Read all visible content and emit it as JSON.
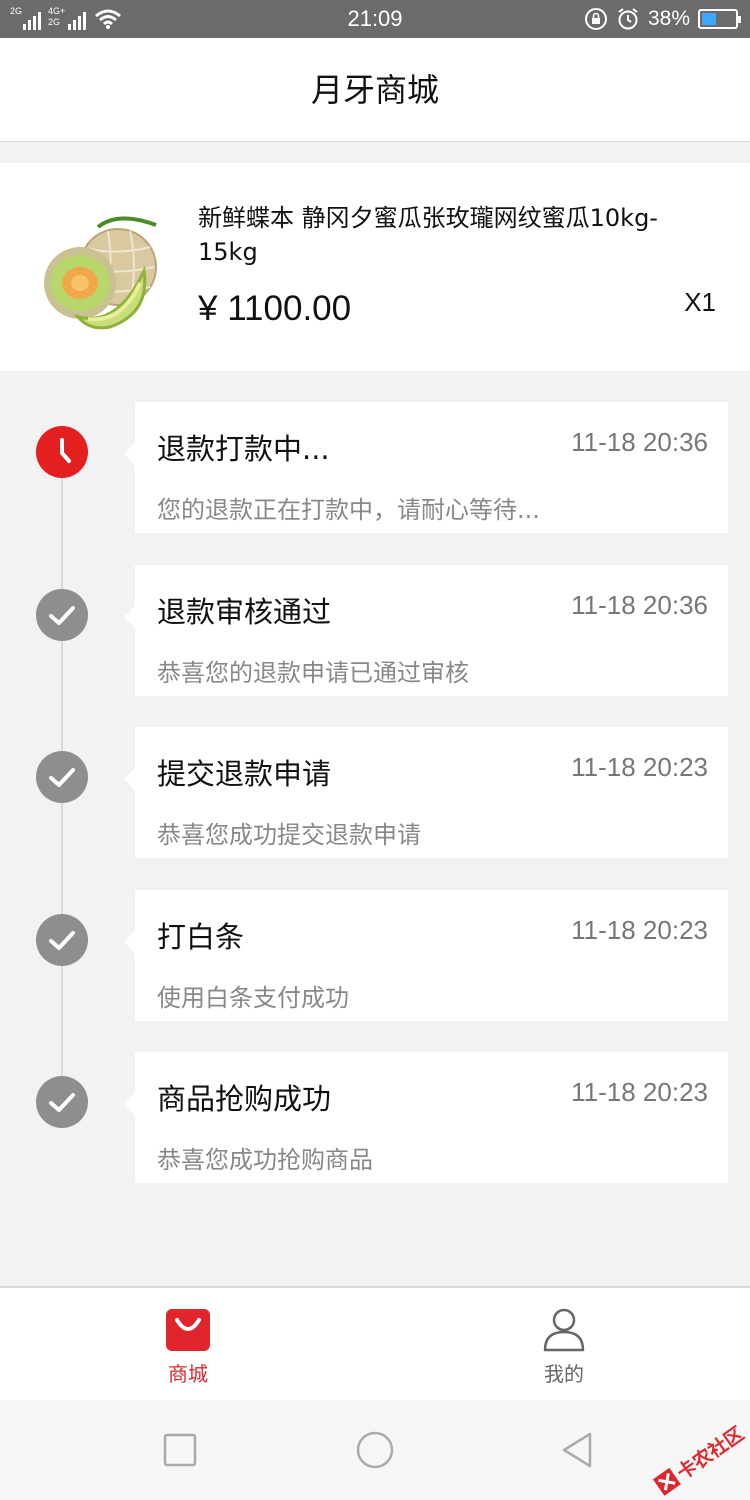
{
  "status_bar": {
    "time": "21:09",
    "battery": "38%",
    "battery_level": 0.38,
    "sim1_label": "2G",
    "sim2_label_top": "4G+",
    "sim2_label_bottom": "2G",
    "icons": [
      "signal-icon",
      "signal-icon",
      "wifi-icon",
      "lock-rotation-icon",
      "alarm-icon",
      "battery-icon"
    ]
  },
  "header": {
    "title": "月牙商城"
  },
  "product": {
    "name": "新鲜蝶本 静冈夕蜜瓜张玫瓏网纹蜜瓜10kg-15kg",
    "price": "¥ 1100.00",
    "quantity": "X1",
    "image_icon": "melon-image"
  },
  "timeline": [
    {
      "title": "退款打款中...",
      "time": "11-18 20:36",
      "desc": "您的退款正在打款中，请耐心等待...",
      "status": "active",
      "icon": "clock-icon"
    },
    {
      "title": "退款审核通过",
      "time": "11-18 20:36",
      "desc": "恭喜您的退款申请已通过审核",
      "status": "done",
      "icon": "check-icon"
    },
    {
      "title": "提交退款申请",
      "time": "11-18 20:23",
      "desc": "恭喜您成功提交退款申请",
      "status": "done",
      "icon": "check-icon"
    },
    {
      "title": "打白条",
      "time": "11-18 20:23",
      "desc": "使用白条支付成功",
      "status": "done",
      "icon": "check-icon"
    },
    {
      "title": "商品抢购成功",
      "time": "11-18 20:23",
      "desc": "恭喜您成功抢购商品",
      "status": "done",
      "icon": "check-icon"
    }
  ],
  "tabbar": {
    "mall": {
      "label": "商城",
      "icon": "shopping-bag-icon",
      "active": true
    },
    "mine": {
      "label": "我的",
      "icon": "user-icon",
      "active": false
    }
  },
  "android_nav": {
    "icons": [
      "recent-apps-icon",
      "home-icon",
      "back-icon"
    ]
  },
  "watermark": {
    "text": "卡农社区"
  },
  "colors": {
    "accent": "#e41f1f",
    "done_gray": "#8e8e8e",
    "background": "#f2f2f5"
  }
}
